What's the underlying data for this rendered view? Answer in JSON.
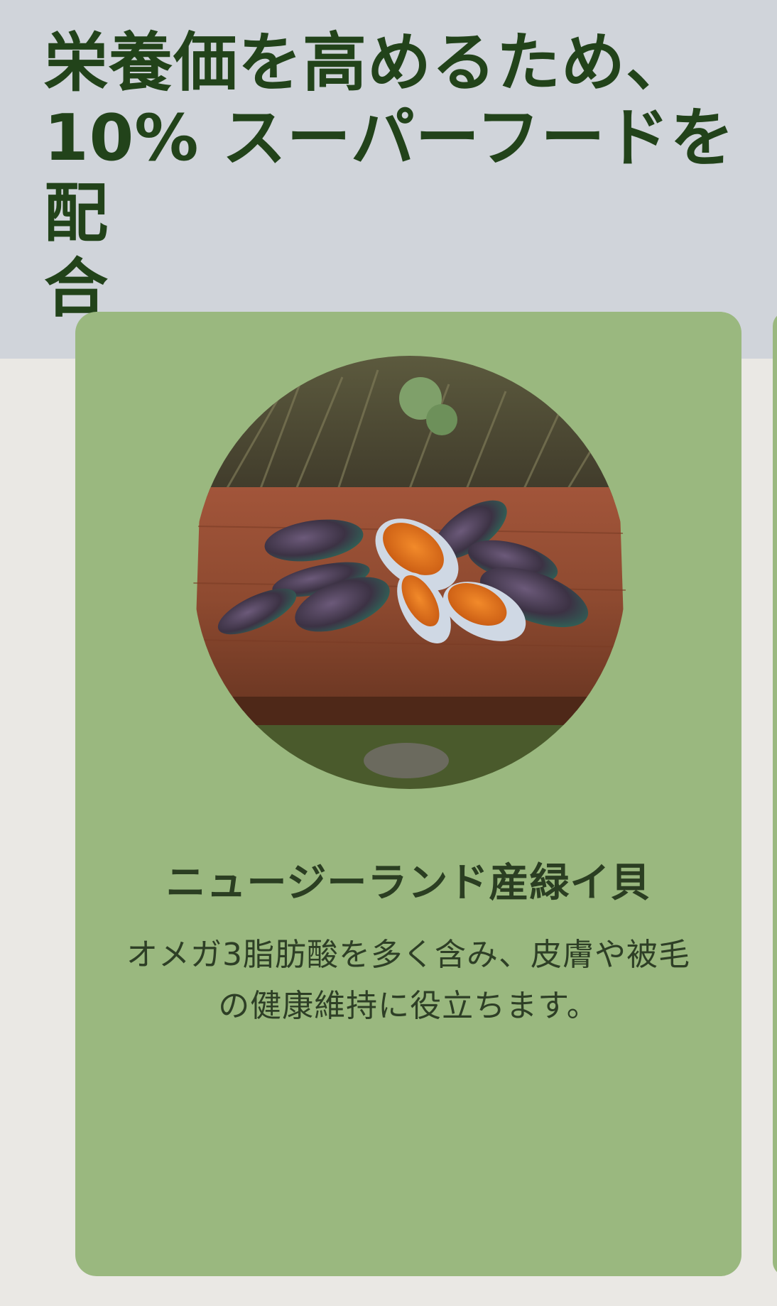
{
  "header": {
    "title": "栄養価を高めるため、\n10% スーパーフードを配\n合"
  },
  "card": {
    "image_icon": "mussels-photo",
    "title": "ニュージーランド産緑イ貝",
    "description": "オメガ3脂肪酸を多く含み、皮膚や被毛の健康維持に役立ちます。"
  },
  "colors": {
    "header_background": "#d0d4da",
    "page_background": "#eae8e4",
    "card_background": "#9ab87f",
    "title_text": "#22431a"
  }
}
